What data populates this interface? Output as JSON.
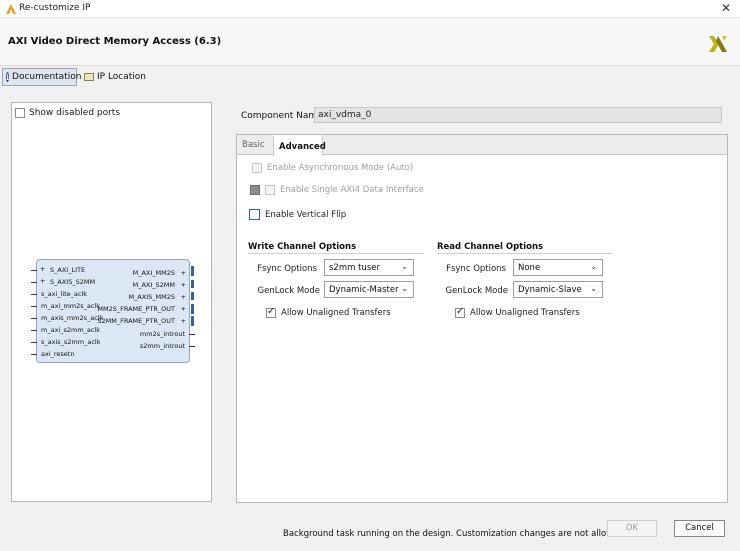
{
  "window": {
    "title": "Re-customize IP",
    "close_glyph": "✕"
  },
  "header": {
    "heading": "AXI Video Direct Memory Access (6.3)",
    "logo_icon": "xilinx-logo"
  },
  "toolbar": {
    "documentation_label": "Documentation",
    "ip_location_label": "IP Location",
    "info_glyph": "i"
  },
  "left_panel": {
    "show_disabled_label": "Show disabled ports",
    "show_disabled_checked": false,
    "symbol": {
      "left_ports": [
        {
          "plus": "+",
          "name": "S_AXI_LITE"
        },
        {
          "plus": "+",
          "name": "S_AXIS_S2MM"
        },
        {
          "plus": "",
          "name": "s_axi_lite_aclk"
        },
        {
          "plus": "",
          "name": "m_axi_mm2s_aclk"
        },
        {
          "plus": "",
          "name": "m_axis_mm2s_aclk"
        },
        {
          "plus": "",
          "name": "m_axi_s2mm_aclk"
        },
        {
          "plus": "",
          "name": "s_axis_s2mm_aclk"
        },
        {
          "plus": "",
          "name": "axi_resetn"
        }
      ],
      "right_ports": [
        {
          "plus": "+",
          "name": "M_AXI_MM2S"
        },
        {
          "plus": "+",
          "name": "M_AXI_S2MM"
        },
        {
          "plus": "+",
          "name": "M_AXIS_MM2S"
        },
        {
          "plus": "+",
          "name": "MM2S_FRAME_PTR_OUT"
        },
        {
          "plus": "+",
          "name": "S2MM_FRAME_PTR_OUT"
        },
        {
          "plus": "",
          "name": "mm2s_introut"
        },
        {
          "plus": "",
          "name": "s2mm_introut"
        }
      ]
    }
  },
  "component": {
    "label": "Component Name",
    "value": "axi_vdma_0"
  },
  "tabs": {
    "basic": "Basic",
    "advanced": "Advanced",
    "active": "Advanced"
  },
  "advanced": {
    "async_mode": {
      "label": "Enable Asynchronous Mode (Auto)",
      "checked": false,
      "enabled": false
    },
    "single_axi4": {
      "label": "Enable Single AXI4 Data Interface",
      "checked": false,
      "enabled": false
    },
    "vertical_flip": {
      "label": "Enable Vertical Flip",
      "checked": false,
      "enabled": true
    },
    "write": {
      "title": "Write Channel Options",
      "fsync_label": "Fsync Options",
      "fsync_value": "s2mm tuser",
      "genlock_label": "GenLock Mode",
      "genlock_value": "Dynamic-Master",
      "unaligned_label": "Allow Unaligned Transfers",
      "unaligned_checked": true
    },
    "read": {
      "title": "Read Channel Options",
      "fsync_label": "Fsync Options",
      "fsync_value": "None",
      "genlock_label": "GenLock Mode",
      "genlock_value": "Dynamic-Slave",
      "unaligned_label": "Allow Unaligned Transfers",
      "unaligned_checked": true
    }
  },
  "footer": {
    "status": "Background task running on the design. Customization changes are not allowed",
    "ok_label": "OK",
    "ok_enabled": false,
    "cancel_label": "Cancel"
  }
}
